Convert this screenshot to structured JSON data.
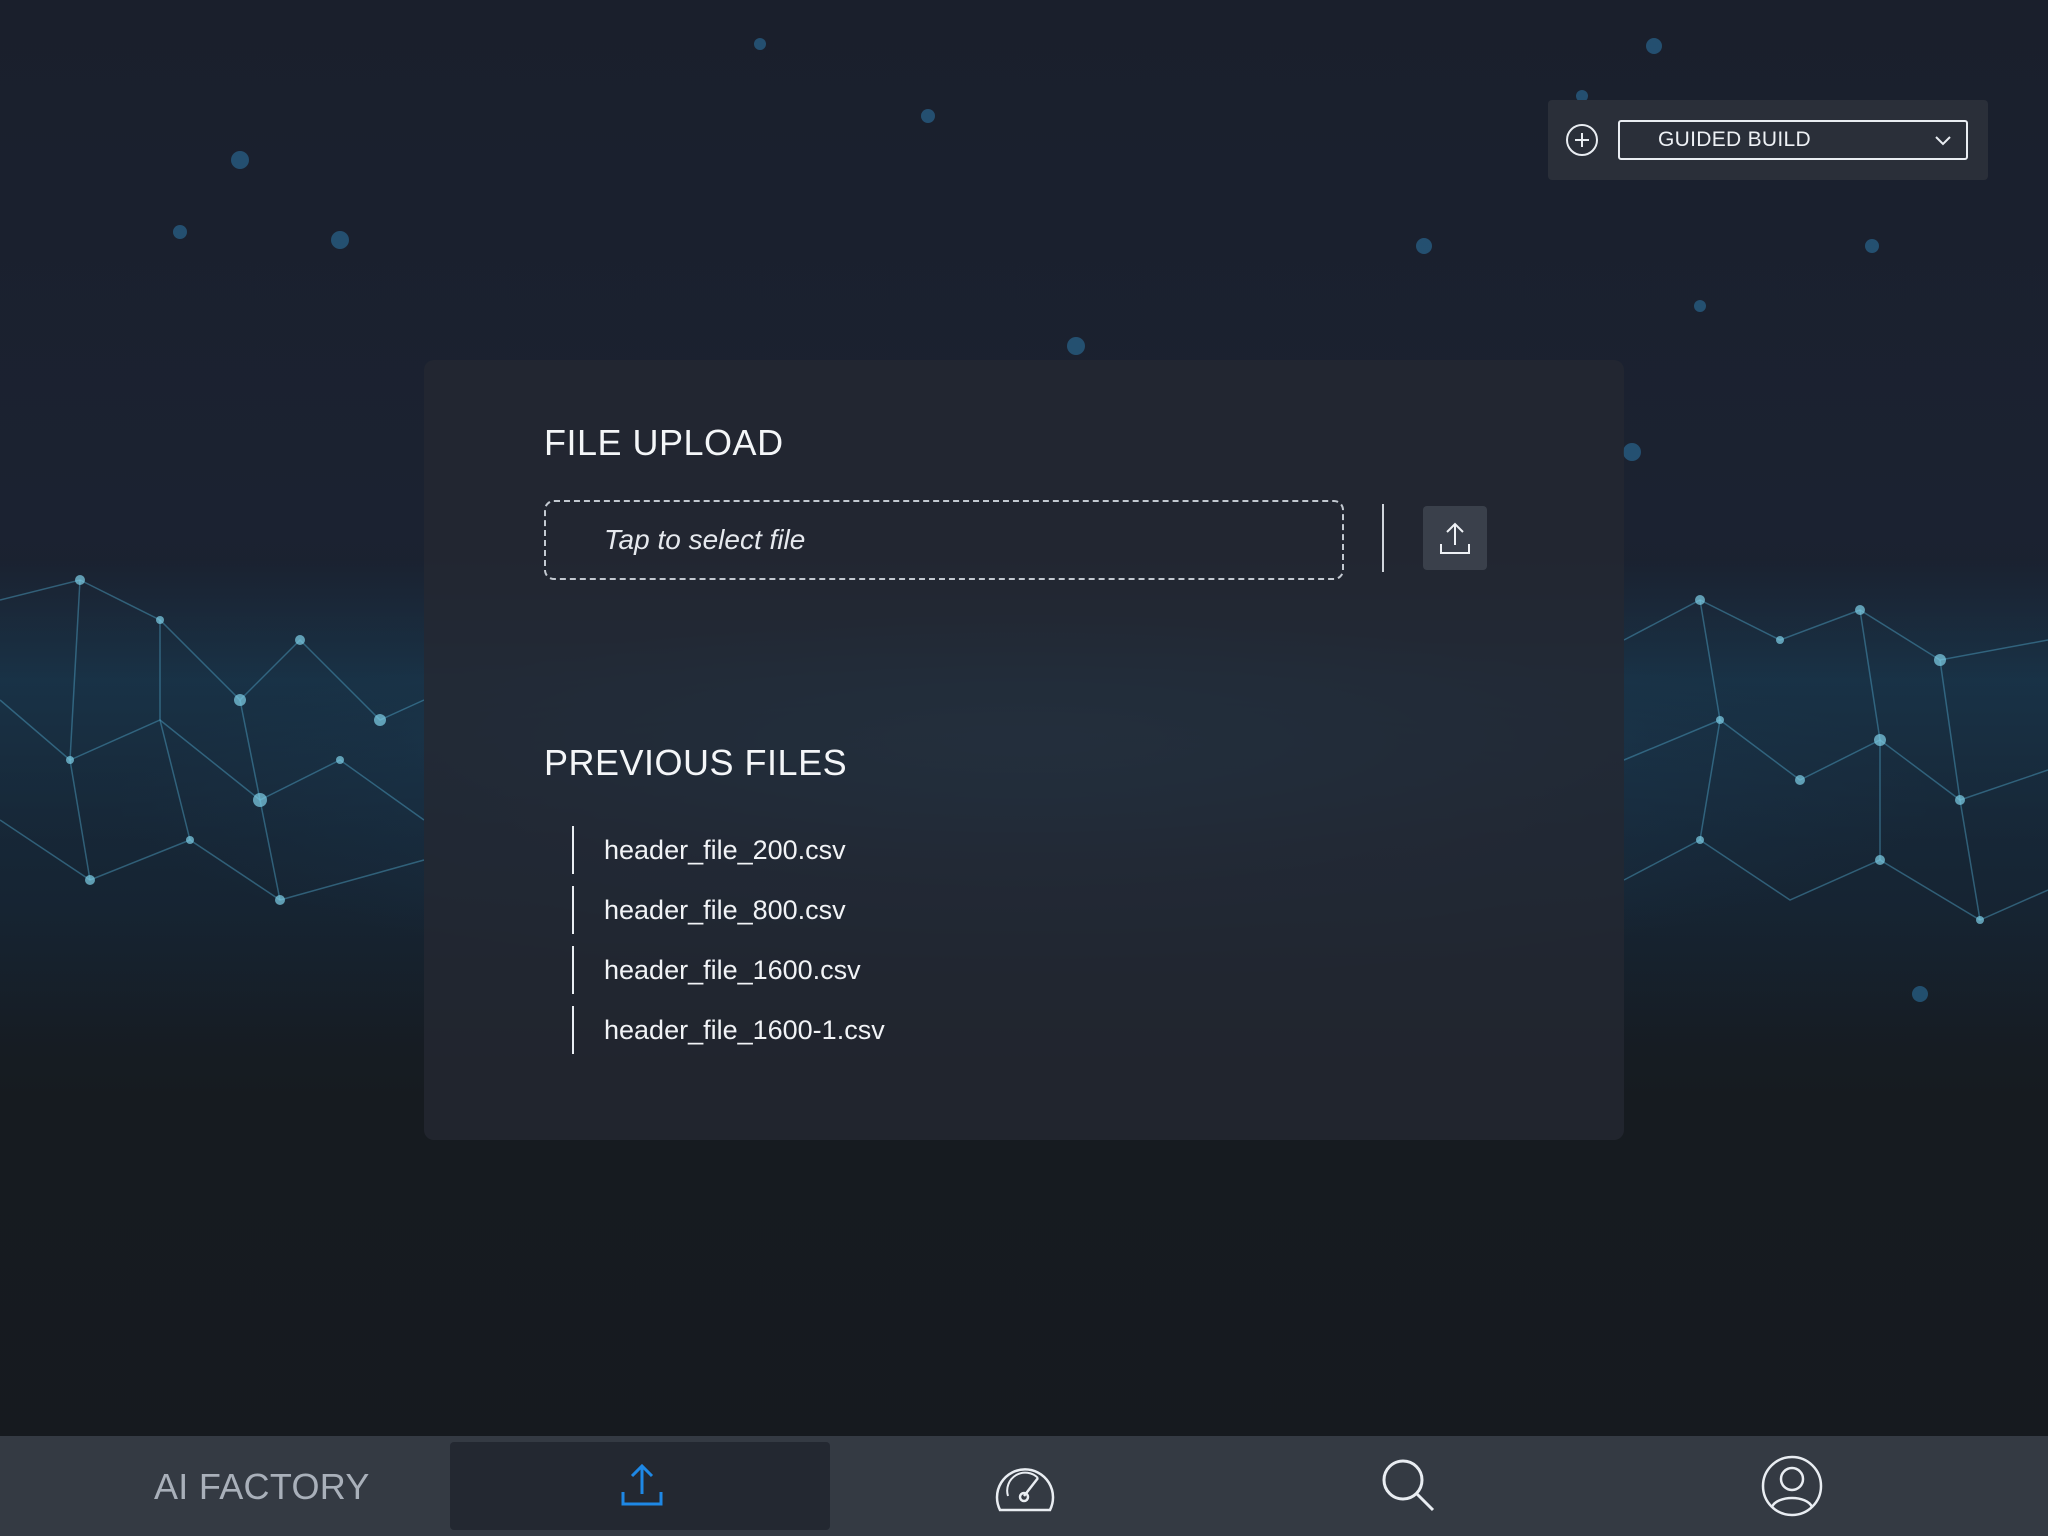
{
  "top_right": {
    "add_icon": "plus-circle-icon",
    "mode_select": {
      "value": "GUIDED BUILD",
      "icon": "chevron-down-icon"
    }
  },
  "card": {
    "upload_title": "FILE UPLOAD",
    "file_input": {
      "placeholder": "Tap to select file"
    },
    "upload_button_icon": "upload-icon",
    "previous_title": "PREVIOUS FILES",
    "previous_files": [
      {
        "name": "header_file_200.csv"
      },
      {
        "name": "header_file_800.csv"
      },
      {
        "name": "header_file_1600.csv"
      },
      {
        "name": "header_file_1600-1.csv"
      }
    ]
  },
  "bottom_nav": {
    "brand": "AI FACTORY",
    "items": [
      {
        "icon": "upload-icon",
        "active": true
      },
      {
        "icon": "gauge-icon",
        "active": false
      },
      {
        "icon": "search-icon",
        "active": false
      },
      {
        "icon": "user-icon",
        "active": false
      }
    ]
  },
  "colors": {
    "accent": "#1e88e5",
    "card_bg": "#242832",
    "nav_bg": "#343a43"
  }
}
